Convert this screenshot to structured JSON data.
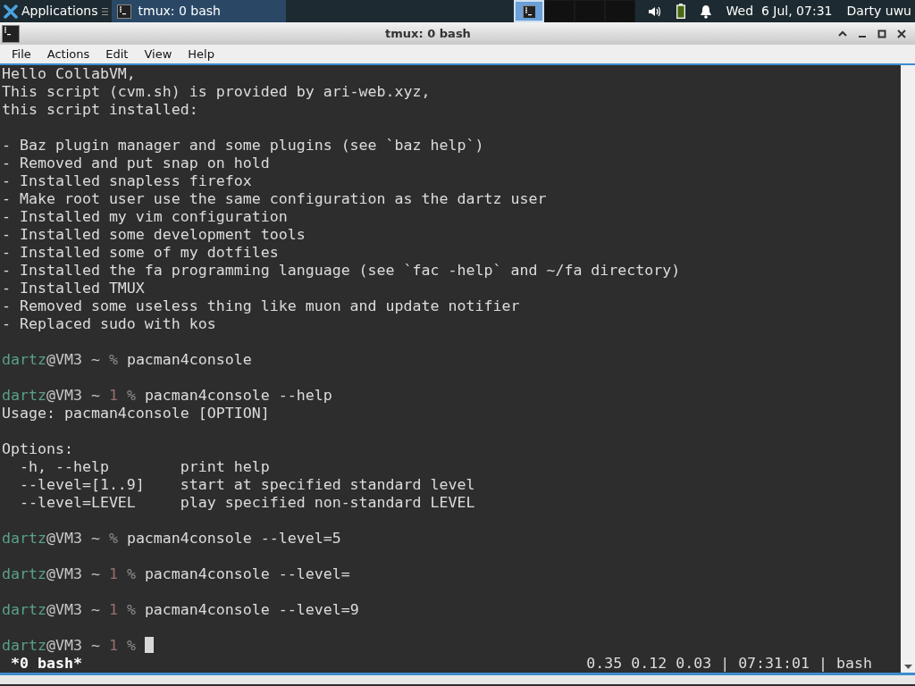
{
  "panel": {
    "applications_label": "Applications",
    "tasks": [
      {
        "title": "tmux: 0 bash",
        "selected": true
      }
    ],
    "workspaces": [
      {
        "selected": true,
        "has_window": true
      },
      {
        "selected": false,
        "has_window": false
      },
      {
        "selected": false,
        "has_window": false
      },
      {
        "selected": false,
        "has_window": false
      }
    ],
    "clock": "Wed  6 Jul, 07:31",
    "user": "Darty uwu"
  },
  "window": {
    "title": "tmux: 0 bash",
    "menu": [
      "File",
      "Actions",
      "Edit",
      "View",
      "Help"
    ]
  },
  "terminal": {
    "lines": [
      {
        "kind": "text",
        "text": "Hello CollabVM,"
      },
      {
        "kind": "text",
        "text": "This script (cvm.sh) is provided by ari-web.xyz,"
      },
      {
        "kind": "text",
        "text": "this script installed:"
      },
      {
        "kind": "blank"
      },
      {
        "kind": "text",
        "text": "- Baz plugin manager and some plugins (see `baz help`)"
      },
      {
        "kind": "text",
        "text": "- Removed and put snap on hold"
      },
      {
        "kind": "text",
        "text": "- Installed snapless firefox"
      },
      {
        "kind": "text",
        "text": "- Make root user use the same configuration as the dartz user"
      },
      {
        "kind": "text",
        "text": "- Installed my vim configuration"
      },
      {
        "kind": "text",
        "text": "- Installed some development tools"
      },
      {
        "kind": "text",
        "text": "- Installed some of my dotfiles"
      },
      {
        "kind": "text",
        "text": "- Installed the fa programming language (see `fac -help` and ~/fa directory)"
      },
      {
        "kind": "text",
        "text": "- Installed TMUX"
      },
      {
        "kind": "text",
        "text": "- Removed some useless thing like muon and update notifier"
      },
      {
        "kind": "text",
        "text": "- Replaced sudo with kos"
      },
      {
        "kind": "blank"
      },
      {
        "kind": "prompt",
        "user": "dartz",
        "host": "@VM3 ~",
        "symbol": "%",
        "command": "pacman4console",
        "cursor": false
      },
      {
        "kind": "blank"
      },
      {
        "kind": "prompt",
        "user": "dartz",
        "host": "@VM3 ~",
        "exit_code": "1",
        "symbol": "%",
        "command": "pacman4console --help",
        "cursor": false
      },
      {
        "kind": "text",
        "text": "Usage: pacman4console [OPTION]"
      },
      {
        "kind": "blank"
      },
      {
        "kind": "text",
        "text": "Options:"
      },
      {
        "kind": "text",
        "text": "  -h, --help        print help"
      },
      {
        "kind": "text",
        "text": "  --level=[1..9]    start at specified standard level"
      },
      {
        "kind": "text",
        "text": "  --level=LEVEL     play specified non-standard LEVEL"
      },
      {
        "kind": "blank"
      },
      {
        "kind": "prompt",
        "user": "dartz",
        "host": "@VM3 ~",
        "symbol": "%",
        "command": "pacman4console --level=5",
        "cursor": false
      },
      {
        "kind": "blank"
      },
      {
        "kind": "prompt",
        "user": "dartz",
        "host": "@VM3 ~",
        "exit_code": "1",
        "symbol": "%",
        "command": "pacman4console --level=",
        "cursor": false
      },
      {
        "kind": "blank"
      },
      {
        "kind": "prompt",
        "user": "dartz",
        "host": "@VM3 ~",
        "exit_code": "1",
        "symbol": "%",
        "command": "pacman4console --level=9",
        "cursor": false
      },
      {
        "kind": "blank"
      },
      {
        "kind": "prompt",
        "user": "dartz",
        "host": "@VM3 ~",
        "exit_code": "1",
        "symbol": "%",
        "cursor": true
      }
    ],
    "status": {
      "left": "*0 bash*",
      "right": "0.35 0.12 0.03 | 07:31:01 | bash"
    }
  }
}
